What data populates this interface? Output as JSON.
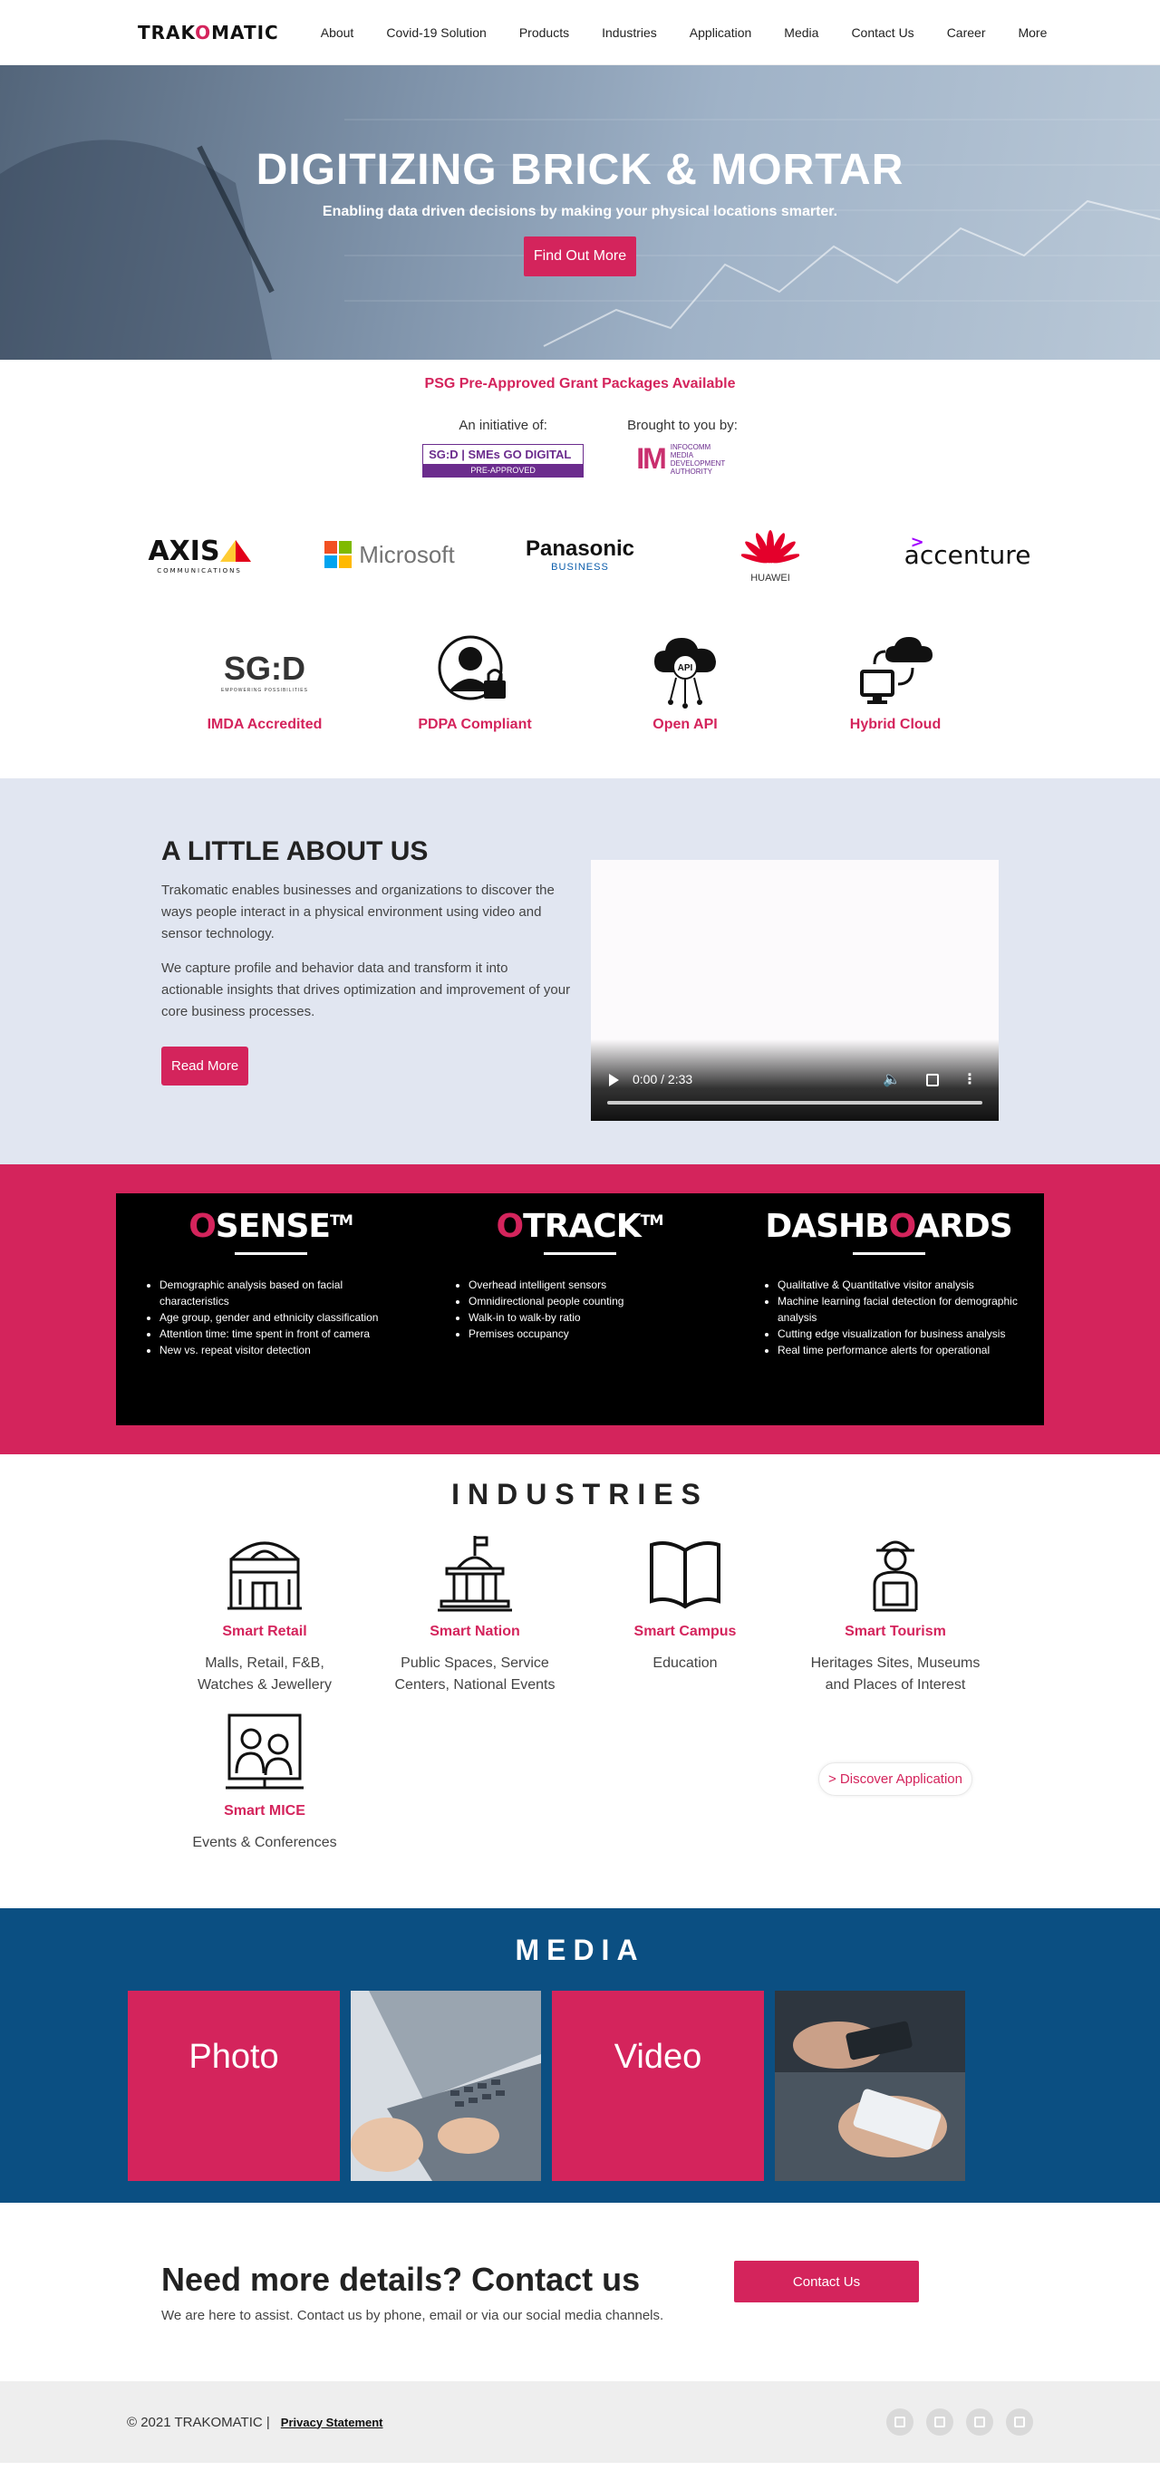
{
  "nav": {
    "logo": {
      "pre": "TRAK",
      "o": "O",
      "post": "MATIC"
    },
    "items": [
      "About",
      "Covid-19 Solution",
      "Products",
      "Industries",
      "Application",
      "Media",
      "Contact Us",
      "Career",
      "More"
    ]
  },
  "hero": {
    "title": "DIGITIZING BRICK & MORTAR",
    "subtitle": "Enabling data driven decisions by making your physical locations smarter.",
    "button": "Find Out More"
  },
  "psg": {
    "title": "PSG Pre-Approved Grant Packages Available",
    "initiative_label": "An initiative of:",
    "brought_label": "Brought to you by:",
    "sgd_logo_top": "SG:D | SMEs GO DIGITAL",
    "sgd_logo_bottom": "PRE-APPROVED",
    "imda_mark": "IM",
    "imda_text": "INFOCOMM MEDIA DEVELOPMENT AUTHORITY"
  },
  "partners": {
    "axis": "AXIS",
    "axis_sub": "COMMUNICATIONS",
    "microsoft": "Microsoft",
    "panasonic": "Panasonic",
    "panasonic_sub": "BUSINESS",
    "huawei": "HUAWEI",
    "accenture": "accenture",
    "accenture_mark": ">"
  },
  "features": {
    "sgd_mark": "SG:D",
    "sgd_sub": "EMPOWERING POSSIBILITIES",
    "items": [
      "IMDA Accredited",
      "PDPA Compliant",
      "Open API",
      "Hybrid Cloud"
    ],
    "api_icon_text": "API"
  },
  "about": {
    "title": "A LITTLE ABOUT US",
    "p1": "Trakomatic enables businesses and organizations to discover the ways people interact in a physical environment using video and sensor technology.",
    "p2": "We capture profile and behavior data and transform it into actionable insights that drives optimization and improvement of your core business processes.",
    "button": "Read More",
    "video_time": "0:00 / 2:33"
  },
  "products": [
    {
      "o": "O",
      "name": "SENSE",
      "tm": "TM",
      "bullets": [
        "Demographic analysis based on facial characteristics",
        "Age group, gender and ethnicity classification",
        "Attention time: time spent in front of camera",
        "New vs. repeat visitor detection"
      ]
    },
    {
      "o": "O",
      "name": "TRACK",
      "tm": "TM",
      "bullets": [
        "Overhead intelligent sensors",
        "Omnidirectional people counting",
        "Walk-in to walk-by ratio",
        "Premises occupancy"
      ]
    },
    {
      "pre": "DASHB",
      "o": "O",
      "post": "ARDS",
      "bullets": [
        "Qualitative & Quantitative visitor analysis",
        "Machine learning facial detection for demographic analysis",
        "Cutting edge visualization for business analysis",
        "Real time performance alerts for operational"
      ]
    }
  ],
  "industries": {
    "title": "INDUSTRIES",
    "items": [
      {
        "name": "Smart Retail",
        "desc": "Malls, Retail, F&B, Watches & Jewellery",
        "icon": "retail-building-icon"
      },
      {
        "name": "Smart Nation",
        "desc": "Public Spaces, Service Centers, National Events",
        "icon": "government-building-icon"
      },
      {
        "name": "Smart Campus",
        "desc": "Education",
        "icon": "open-book-icon"
      },
      {
        "name": "Smart Tourism",
        "desc": "Heritages Sites, Museums and Places of Interest",
        "icon": "tourist-icon"
      },
      {
        "name": "Smart MICE",
        "desc": "Events & Conferences",
        "icon": "conference-icon"
      }
    ],
    "discover": "> Discover Application"
  },
  "media": {
    "title": "MEDIA",
    "photo": "Photo",
    "video": "Video"
  },
  "contact": {
    "title": "Need more details? Contact us",
    "subtitle": "We are here to assist. Contact us by phone, email or via our social media channels.",
    "button": "Contact Us"
  },
  "footer": {
    "copyright": "© 2021 TRAKOMATIC |",
    "privacy": "Privacy Statement",
    "social": [
      "blog-icon",
      "youtube-icon",
      "facebook-icon",
      "linkedin-icon"
    ]
  },
  "colors": {
    "brand": "#d4245c",
    "about_bg": "#e1e6f1",
    "media_bg": "#0b4f82",
    "footer_bg": "#eeeeee"
  }
}
